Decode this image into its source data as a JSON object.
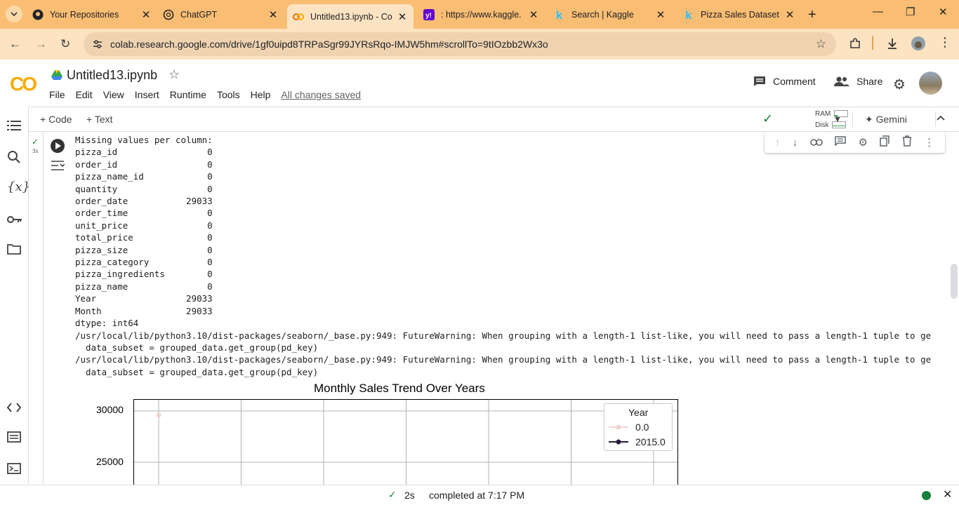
{
  "browser": {
    "tabs": [
      {
        "title": "Your Repositories",
        "icon": "github-icon"
      },
      {
        "title": "ChatGPT",
        "icon": "chatgpt-icon"
      },
      {
        "title": "Untitled13.ipynb - Co",
        "icon": "colab-icon"
      },
      {
        "title": ": https://www.kaggle.",
        "icon": "yahoo-icon"
      },
      {
        "title": "Search | Kaggle",
        "icon": "kaggle-icon"
      },
      {
        "title": "Pizza Sales Dataset",
        "icon": "kaggle-icon"
      }
    ],
    "url": "colab.research.google.com/drive/1gf0uipd8TRPaSgr99JYRsRqo-IMJW5hm#scrollTo=9tIOzbb2Wx3o"
  },
  "colab": {
    "logo": "CO",
    "notebook_title": "Untitled13.ipynb",
    "menu": [
      "File",
      "Edit",
      "View",
      "Insert",
      "Runtime",
      "Tools",
      "Help"
    ],
    "saved_status": "All changes saved",
    "comment_label": "Comment",
    "share_label": "Share"
  },
  "toolbar": {
    "code_label": "+ Code",
    "text_label": "+ Text",
    "ram_label": "RAM",
    "disk_label": "Disk",
    "gemini_label": "Gemini"
  },
  "cell": {
    "exec_time": "3s",
    "output_lines": [
      "Missing values per column:",
      "pizza_id                 0",
      "order_id                 0",
      "pizza_name_id            0",
      "quantity                 0",
      "order_date           29033",
      "order_time               0",
      "unit_price               0",
      "total_price              0",
      "pizza_size               0",
      "pizza_category           0",
      "pizza_ingredients        0",
      "pizza_name               0",
      "Year                 29033",
      "Month                29033",
      "dtype: int64",
      "/usr/local/lib/python3.10/dist-packages/seaborn/_base.py:949: FutureWarning: When grouping with a length-1 list-like, you will need to pass a length-1 tuple to ge",
      "  data_subset = grouped_data.get_group(pd_key)",
      "/usr/local/lib/python3.10/dist-packages/seaborn/_base.py:949: FutureWarning: When grouping with a length-1 list-like, you will need to pass a length-1 tuple to ge",
      "  data_subset = grouped_data.get_group(pd_key)"
    ]
  },
  "chart_data": {
    "type": "line",
    "title": "Monthly Sales Trend Over Years",
    "yticks": [
      "30000",
      "25000"
    ],
    "legend_title": "Year",
    "series": [
      {
        "name": "0.0",
        "color": "#f0d3cf",
        "points": [
          {
            "x": 1,
            "y": 29600
          }
        ]
      },
      {
        "name": "2015.0",
        "color": "#2b1d3f",
        "points": []
      }
    ],
    "grid": true,
    "legend_position": "top-right"
  },
  "status": {
    "elapsed": "2s",
    "completed": "completed at 7:17 PM"
  }
}
